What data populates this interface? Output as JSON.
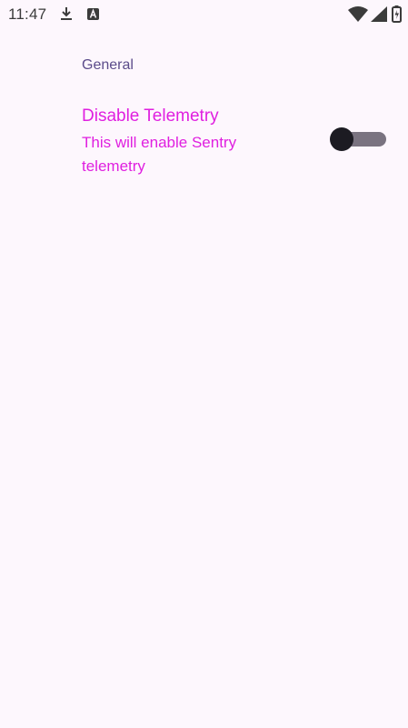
{
  "status_bar": {
    "time": "11:47",
    "icons": [
      "download-icon",
      "a-badge-icon",
      "wifi-icon",
      "signal-icon",
      "battery-icon"
    ]
  },
  "settings": {
    "section_header": "General",
    "items": [
      {
        "title": "Disable Telemetry",
        "summary": "This will enable Sentry telemetry",
        "toggle_state": "off"
      }
    ]
  },
  "colors": {
    "background": "#fdf7fd",
    "section_header": "#5b4b8a",
    "item_text": "#e020e0",
    "toggle_track": "#7a7380",
    "toggle_thumb": "#1c1b22"
  }
}
